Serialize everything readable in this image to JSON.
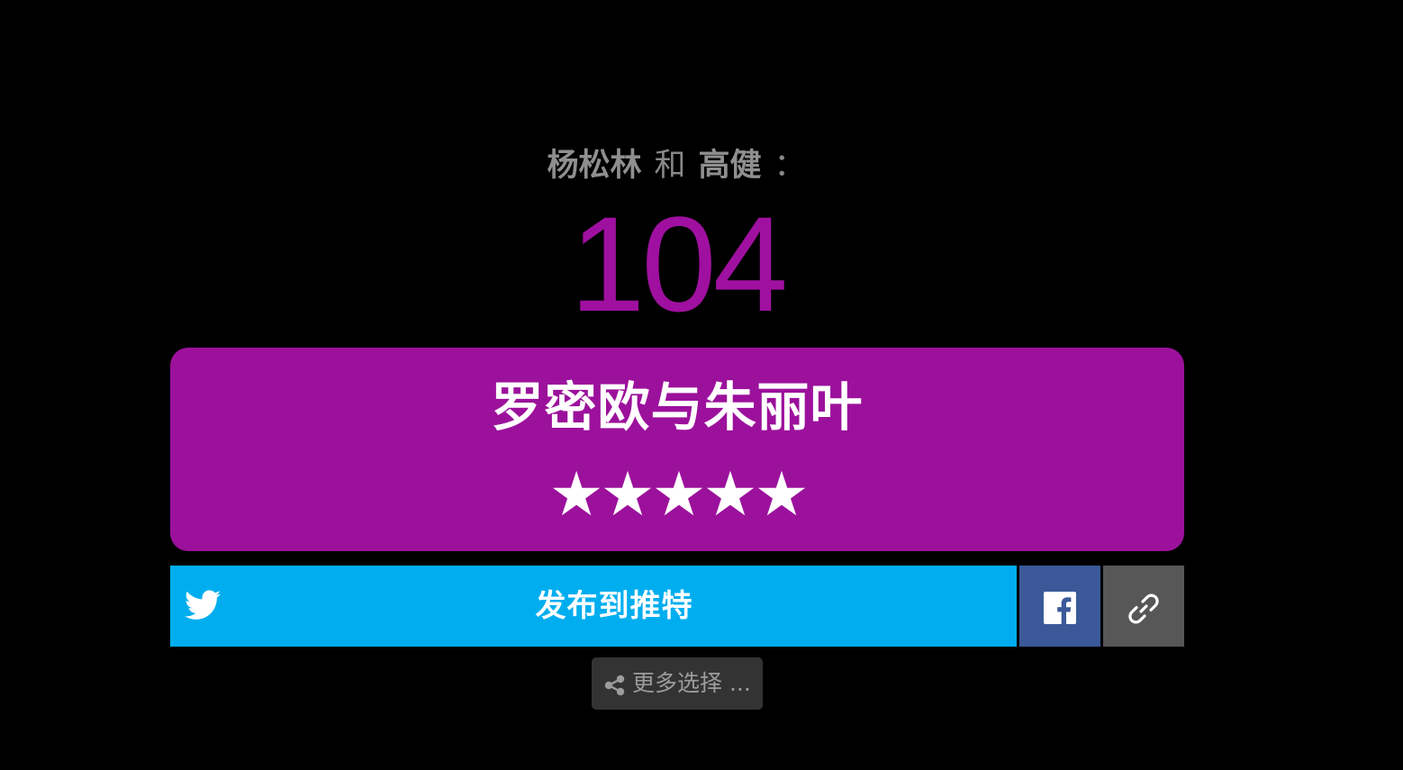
{
  "header": {
    "name_1": "杨松林",
    "conjunction": "和",
    "name_2": "高健",
    "colon": "："
  },
  "score": "104",
  "card": {
    "title": "罗密欧与朱丽叶",
    "stars": "★★★★★",
    "rating": 5,
    "rating_max": 5
  },
  "share": {
    "twitter_label": "发布到推特",
    "more_label": "更多选择 ..."
  },
  "colors": {
    "background": "#000000",
    "accent": "#9c119c",
    "twitter": "#00aeef",
    "facebook": "#3b5998",
    "link": "#575757",
    "more": "#333333"
  },
  "icons": {
    "twitter": "twitter-bird-icon",
    "facebook": "facebook-icon",
    "link": "chain-link-icon",
    "share": "share-icon"
  }
}
